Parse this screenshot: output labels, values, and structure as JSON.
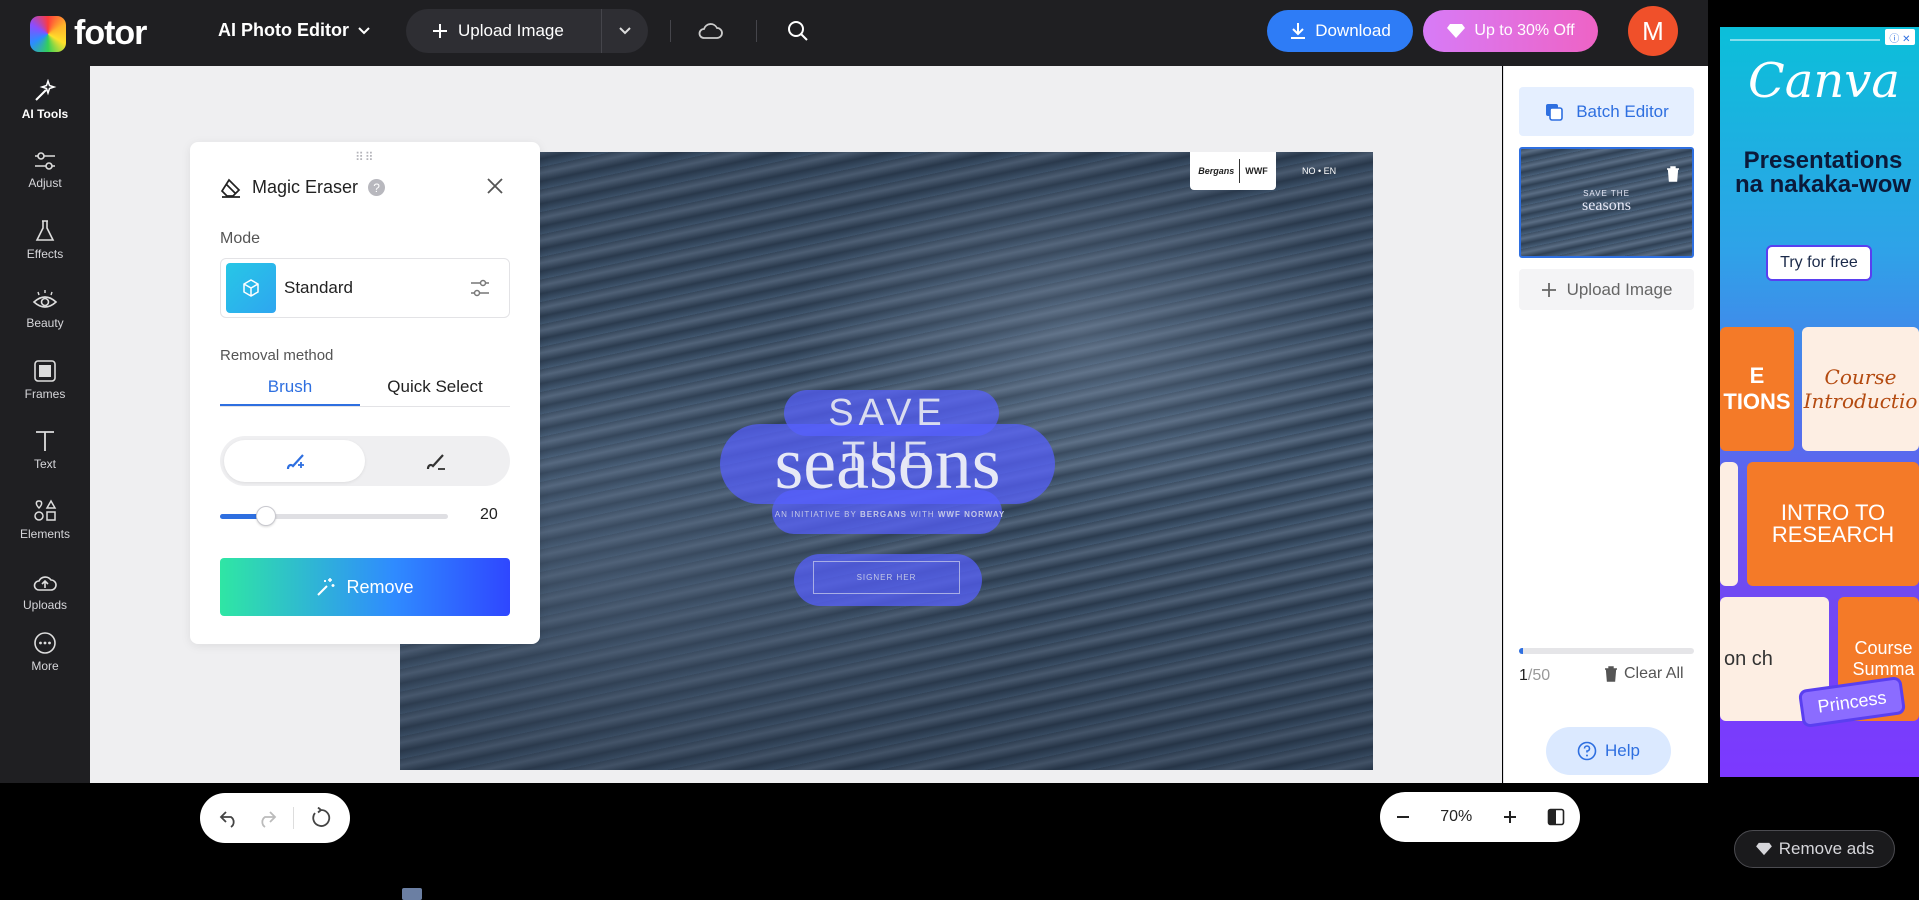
{
  "topbar": {
    "logo_text": "fotor",
    "app_menu_label": "AI Photo Editor",
    "upload_label": "Upload Image",
    "download_label": "Download",
    "promo_label": "Up to 30% Off",
    "avatar_initial": "M"
  },
  "leftnav": {
    "items": [
      {
        "label": "AI Tools",
        "icon": "sparkle-wand-icon",
        "active": true
      },
      {
        "label": "Adjust",
        "icon": "sliders-icon"
      },
      {
        "label": "Effects",
        "icon": "flask-icon"
      },
      {
        "label": "Beauty",
        "icon": "eye-icon"
      },
      {
        "label": "Frames",
        "icon": "frame-icon"
      },
      {
        "label": "Text",
        "icon": "text-icon"
      },
      {
        "label": "Elements",
        "icon": "shapes-icon"
      },
      {
        "label": "Uploads",
        "icon": "cloud-upload-icon"
      },
      {
        "label": "More",
        "icon": "more-dots-icon"
      }
    ]
  },
  "panel": {
    "title": "Magic Eraser",
    "mode_label": "Mode",
    "mode_value": "Standard",
    "removal_label": "Removal method",
    "tabs": [
      {
        "label": "Brush",
        "active": true
      },
      {
        "label": "Quick Select",
        "active": false
      }
    ],
    "brush_size": "20",
    "brush_size_fraction": 0.2,
    "remove_label": "Remove"
  },
  "canvas": {
    "line1": "SAVE THE",
    "line2": "seasons",
    "line3_prefix": "AN INITIATIVE BY",
    "line3_brand": "BERGANS",
    "line3_with": "WITH",
    "line3_partner": "WWF NORWAY",
    "cta": "SIGNER HER",
    "lang": "NO • EN",
    "badge_brand": "Bergans",
    "badge_partner": "WWF"
  },
  "zoom": {
    "value": "70%"
  },
  "rightpanel": {
    "batch_label": "Batch Editor",
    "upload_label": "Upload Image",
    "count_current": "1",
    "count_total": "/50",
    "progress_fraction": 0.02,
    "clear_label": "Clear All",
    "help_label": "Help"
  },
  "ad": {
    "brand": "Canva",
    "headline": "Presentations na nakaka-wow",
    "cta": "Try for free",
    "card_1": "E TIONS",
    "card_2_line1": "Course",
    "card_2_line2": "Introductio",
    "card_3": "INTRO TO RESEARCH",
    "card_4": "on ch",
    "card_5": "Course Summa",
    "badge": "Princess",
    "remove_ads_label": "Remove ads"
  },
  "colors": {
    "accent": "#2e6fe0",
    "download": "#2e7cf6",
    "brush_overlay": "#5660ff",
    "avatar": "#f0502a"
  }
}
